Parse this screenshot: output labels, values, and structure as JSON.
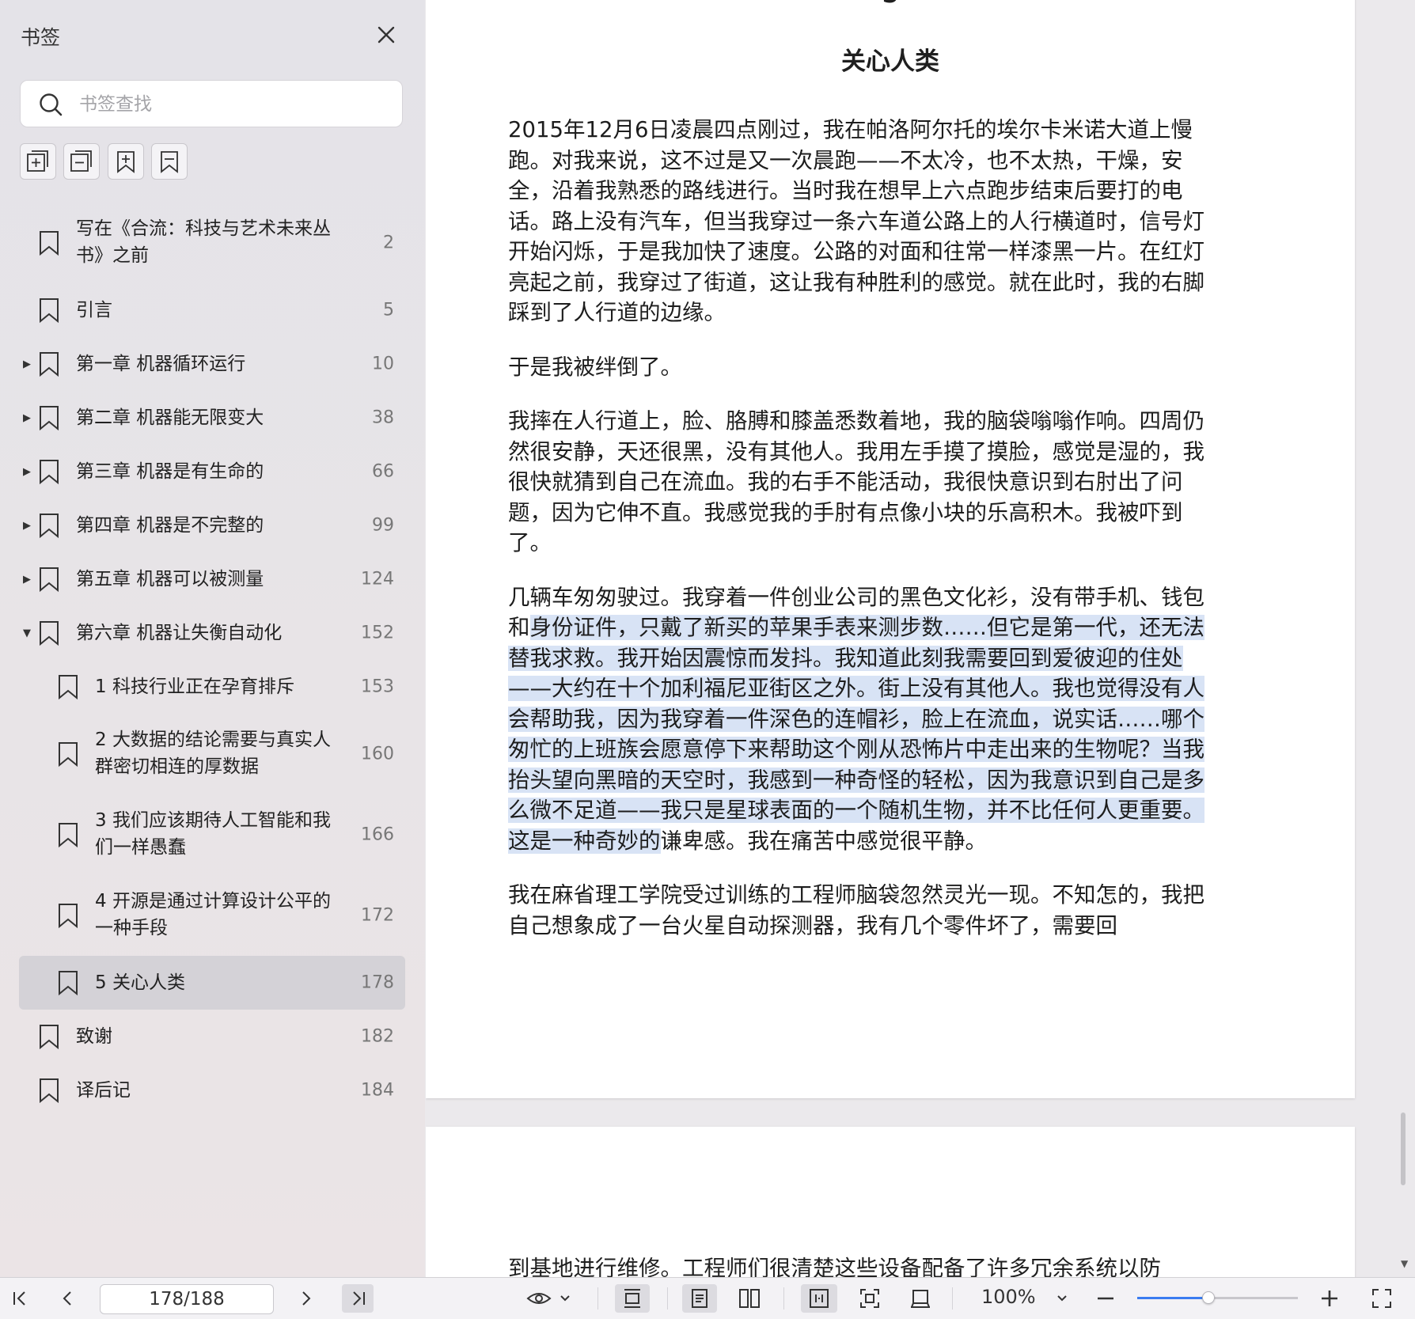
{
  "sidebar": {
    "title": "书签",
    "search_placeholder": "书签查找",
    "tools": [
      "expand-all-icon",
      "collapse-all-icon",
      "add-bookmark-icon",
      "bookmark-outline-icon"
    ],
    "items": [
      {
        "label": "写在《合流：科技与艺术未来丛书》之前",
        "page": "2",
        "level": 0,
        "arrow": ""
      },
      {
        "label": "引言",
        "page": "5",
        "level": 0,
        "arrow": ""
      },
      {
        "label": "第一章 机器循环运行",
        "page": "10",
        "level": 0,
        "arrow": "▶"
      },
      {
        "label": "第二章 机器能无限变大",
        "page": "38",
        "level": 0,
        "arrow": "▶"
      },
      {
        "label": "第三章 机器是有生命的",
        "page": "66",
        "level": 0,
        "arrow": "▶"
      },
      {
        "label": "第四章 机器是不完整的",
        "page": "99",
        "level": 0,
        "arrow": "▶"
      },
      {
        "label": "第五章 机器可以被测量",
        "page": "124",
        "level": 0,
        "arrow": "▶"
      },
      {
        "label": "第六章 机器让失衡自动化",
        "page": "152",
        "level": 0,
        "arrow": "▼"
      },
      {
        "label": "1 科技行业正在孕育排斥",
        "page": "153",
        "level": 1,
        "arrow": ""
      },
      {
        "label": "2 大数据的结论需要与真实人群密切相连的厚数据",
        "page": "160",
        "level": 1,
        "arrow": ""
      },
      {
        "label": "3 我们应该期待人工智能和我们一样愚蠢",
        "page": "166",
        "level": 1,
        "arrow": ""
      },
      {
        "label": "4 开源是通过计算设计公平的一种手段",
        "page": "172",
        "level": 1,
        "arrow": ""
      },
      {
        "label": "5 关心人类",
        "page": "178",
        "level": 1,
        "arrow": "",
        "active": true
      },
      {
        "label": "致谢",
        "page": "182",
        "level": 0,
        "arrow": ""
      },
      {
        "label": "译后记",
        "page": "184",
        "level": 0,
        "arrow": ""
      }
    ]
  },
  "document": {
    "chapter_number": "5",
    "chapter_title": "关心人类",
    "p1": "2015年12月6日凌晨四点刚过，我在帕洛阿尔托的埃尔卡米诺大道上慢跑。对我来说，这不过是又一次晨跑——不太冷，也不太热，干燥，安全，沿着我熟悉的路线进行。当时我在想早上六点跑步结束后要打的电话。路上没有汽车，但当我穿过一条六车道公路上的人行横道时，信号灯开始闪烁，于是我加快了速度。公路的对面和往常一样漆黑一片。在红灯亮起之前，我穿过了街道，这让我有种胜利的感觉。就在此时，我的右脚踩到了人行道的边缘。",
    "p2": "于是我被绊倒了。",
    "p3": "我摔在人行道上，脸、胳膊和膝盖悉数着地，我的脑袋嗡嗡作响。四周仍然很安静，天还很黑，没有其他人。我用左手摸了摸脸，感觉是湿的，我很快就猜到自己在流血。我的右手不能活动，我很快意识到右肘出了问题，因为它伸不直。我感觉我的手肘有点像小块的乐高积木。我被吓到了。",
    "p4_pre": "几辆车匆匆驶过。我穿着一件创业公司的黑色文化衫，没有带手机、钱包和",
    "p4_hl": "身份证件，只戴了新买的苹果手表来测步数……但它是第一代，还无法替我求救。我开始因震惊而发抖。我知道此刻我需要回到爱彼迎的住处——大约在十个加利福尼亚街区之外。街上没有其他人。我也觉得没有人会帮助我，因为我穿着一件深色的连帽衫，脸上在流血，说实话……哪个匆忙的上班族会愿意停下来帮助这个刚从恐怖片中走出来的生物呢？当我抬头望向黑暗的天空时，我感到一种奇怪的轻松，因为我意识到自己是多么微不足道——我只是星球表面的一个随机生物，并不比任何人更重要。这是一种奇妙的",
    "p4_post": "谦卑感。我在痛苦中感觉很平静。",
    "p5": "我在麻省理工学院受过训练的工程师脑袋忽然灵光一现。不知怎的，我把自己想象成了一台火星自动探测器，我有几个零件坏了，需要回",
    "next_page_text": "到基地进行维修。工程师们很清楚这些设备配备了许多冗余系统以防"
  },
  "toolbar": {
    "page_indicator": "178/188",
    "zoom": "100%",
    "zoom_level": 0.44
  }
}
